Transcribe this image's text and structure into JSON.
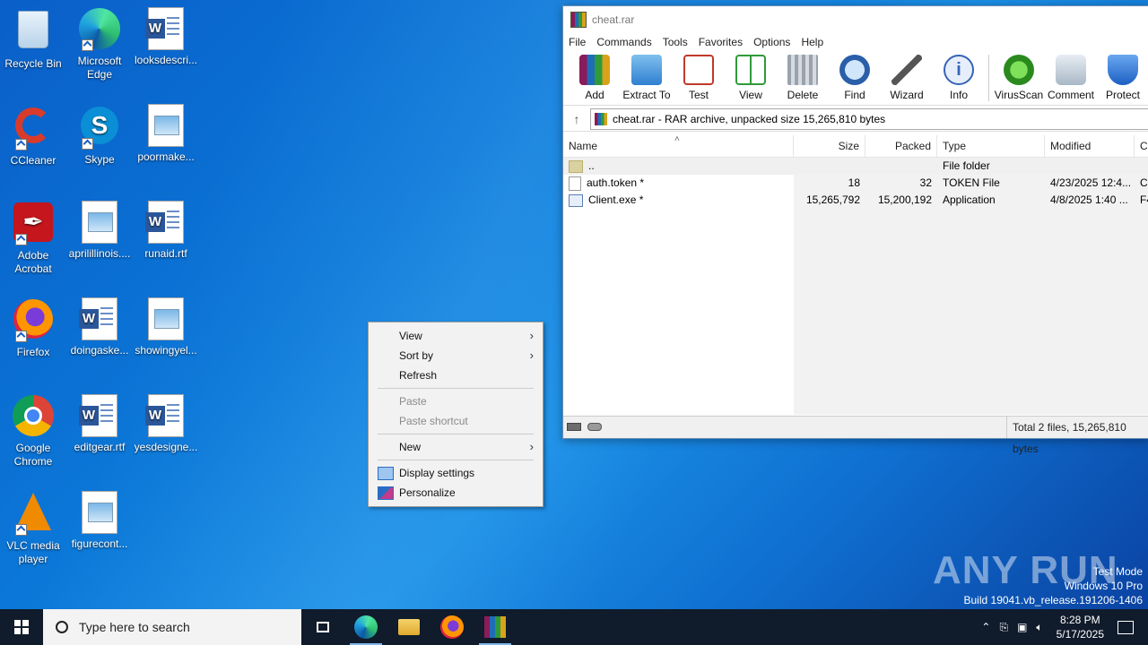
{
  "desktop": {
    "icons": [
      {
        "label": "Recycle Bin"
      },
      {
        "label": "Microsoft Edge"
      },
      {
        "label": "looksdescri..."
      },
      {
        "label": "CCleaner"
      },
      {
        "label": "Skype"
      },
      {
        "label": "poormake..."
      },
      {
        "label": "Adobe Acrobat"
      },
      {
        "label": "aprilillinois...."
      },
      {
        "label": "runaid.rtf"
      },
      {
        "label": "Firefox"
      },
      {
        "label": "doingaske..."
      },
      {
        "label": "showingyel..."
      },
      {
        "label": "Google Chrome"
      },
      {
        "label": "editgear.rtf"
      },
      {
        "label": "yesdesigne..."
      },
      {
        "label": "VLC media player"
      },
      {
        "label": "figurecont..."
      }
    ]
  },
  "winrar": {
    "title": "cheat.rar",
    "menu": [
      "File",
      "Commands",
      "Tools",
      "Favorites",
      "Options",
      "Help"
    ],
    "toolbar": [
      "Add",
      "Extract To",
      "Test",
      "View",
      "Delete",
      "Find",
      "Wizard",
      "Info",
      "VirusScan",
      "Comment",
      "Protect"
    ],
    "address": "cheat.rar - RAR archive, unpacked size 15,265,810 bytes",
    "columns": {
      "name": "Name",
      "size": "Size",
      "packed": "Packed",
      "type": "Type",
      "modified": "Modified",
      "extra": "C"
    },
    "rows": [
      {
        "name": "..",
        "size": "",
        "packed": "",
        "type": "File folder",
        "modified": "",
        "extra": ""
      },
      {
        "name": "auth.token *",
        "size": "18",
        "packed": "32",
        "type": "TOKEN File",
        "modified": "4/23/2025 12:4...",
        "extra": "C"
      },
      {
        "name": "Client.exe *",
        "size": "15,265,792",
        "packed": "15,200,192",
        "type": "Application",
        "modified": "4/8/2025 1:40 ...",
        "extra": "F4"
      }
    ],
    "status": "Total 2 files, 15,265,810 bytes"
  },
  "context_menu": {
    "view": "View",
    "sort_by": "Sort by",
    "refresh": "Refresh",
    "paste": "Paste",
    "paste_shortcut": "Paste shortcut",
    "new": "New",
    "display_settings": "Display settings",
    "personalize": "Personalize"
  },
  "taskbar": {
    "search_placeholder": "Type here to search",
    "time": "8:28 PM",
    "date": "5/17/2025"
  },
  "watermark": {
    "brand": "ANY RUN",
    "line1": "Test Mode",
    "line2": "Windows 10 Pro",
    "line3": "Build 19041.vb_release.191206-1406"
  }
}
